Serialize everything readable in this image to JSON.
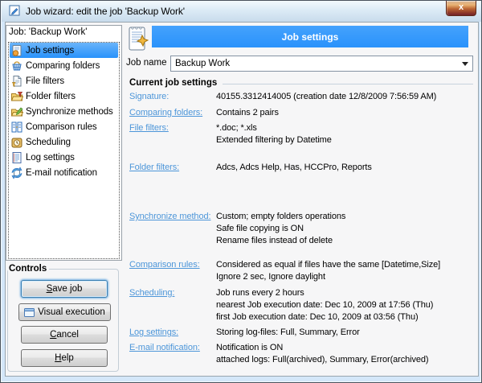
{
  "titlebar": {
    "title": "Job wizard: edit the job 'Backup Work'"
  },
  "sidebar": {
    "header": "Job: 'Backup Work'",
    "items": [
      {
        "label": "Job settings",
        "icon": "notepad-gear-icon",
        "selected": true
      },
      {
        "label": "Comparing folders",
        "icon": "basket-icon",
        "selected": false
      },
      {
        "label": "File filters",
        "icon": "page-funnel-icon",
        "selected": false
      },
      {
        "label": "Folder filters",
        "icon": "folder-funnel-icon",
        "selected": false
      },
      {
        "label": "Synchronize methods",
        "icon": "folder-pencil-icon",
        "selected": false
      },
      {
        "label": "Comparison rules",
        "icon": "columns-icon",
        "selected": false
      },
      {
        "label": "Scheduling",
        "icon": "clock-icon",
        "selected": false
      },
      {
        "label": "Log settings",
        "icon": "lined-page-icon",
        "selected": false
      },
      {
        "label": "E-mail notification",
        "icon": "mail-sync-icon",
        "selected": false
      }
    ]
  },
  "controls": {
    "legend": "Controls",
    "save": "Save job",
    "visual": "Visual execution",
    "cancel": "Cancel",
    "help": "Help"
  },
  "content": {
    "header": "Job settings",
    "job_name_label": "Job name",
    "job_name_value": "Backup Work",
    "section_title": "Current job settings",
    "rows": [
      {
        "label": "Signature:",
        "underlined": false,
        "values": [
          "40155.3312414005 (creation date 12/8/2009 7:56:59 AM)"
        ]
      },
      {
        "label": "Comparing folders:",
        "underlined": true,
        "values": [
          "Contains 2 pairs"
        ]
      },
      {
        "label": "File filters:",
        "underlined": true,
        "values": [
          "*.doc; *.xls",
          "Extended filtering by Datetime"
        ]
      },
      {
        "label": "Folder filters:",
        "underlined": true,
        "values": [
          "Adcs, Adcs Help, Has, HCCPro, Reports"
        ]
      },
      {
        "label": "Synchronize method:",
        "underlined": true,
        "values": [
          "Custom; empty folders operations",
          "Safe file copying is ON",
          "Rename files instead of delete"
        ]
      },
      {
        "label": "Comparison rules:",
        "underlined": true,
        "values": [
          "Considered as equal if files have the same [Datetime,Size]",
          "Ignore 2 sec, Ignore daylight"
        ]
      },
      {
        "label": "Scheduling:",
        "underlined": true,
        "values": [
          "Job runs every 2 hours",
          "nearest Job execution date: Dec 10, 2009 at 17:56 (Thu)",
          "first Job execution date: Dec 10, 2009 at 03:56 (Thu)"
        ]
      },
      {
        "label": "Log settings:",
        "underlined": true,
        "values": [
          "Storing log-files: Full, Summary, Error"
        ]
      },
      {
        "label": "E-mail notification:",
        "underlined": true,
        "values": [
          "Notification is ON",
          "attached logs: Full(archived), Summary, Error(archived)"
        ]
      }
    ]
  },
  "colors": {
    "accent_blue": "#349afc",
    "link_blue": "#4d96d9",
    "close_red": "#bc6634"
  }
}
